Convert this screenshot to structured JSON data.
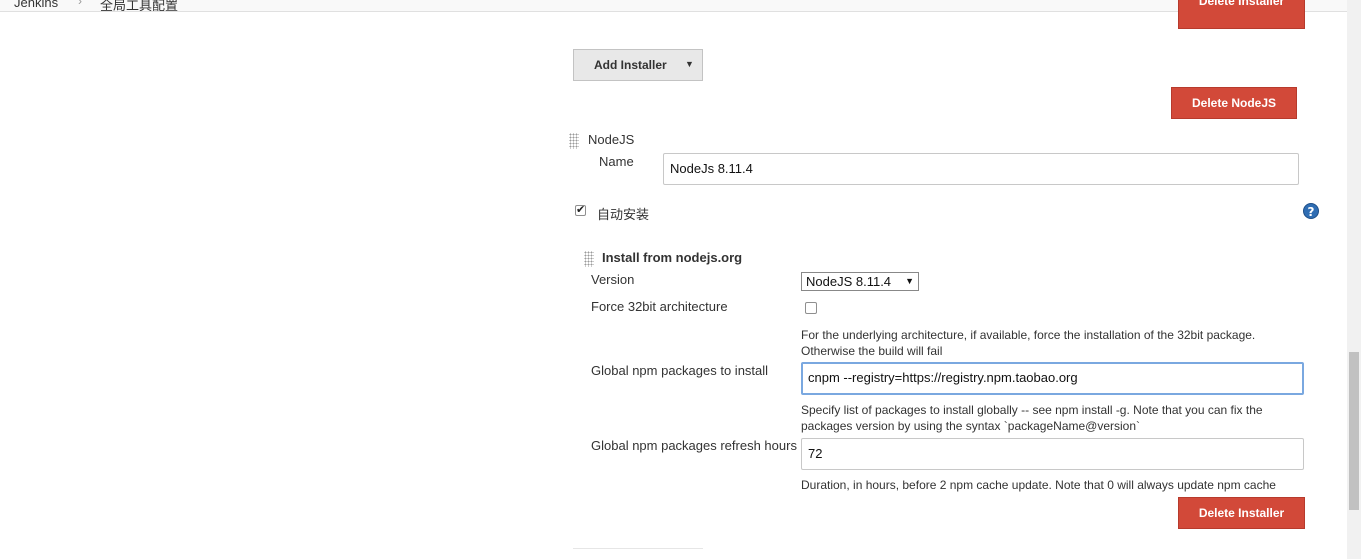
{
  "breadcrumb": {
    "item1": "Jenkins",
    "item2": "全局工具配置"
  },
  "buttons": {
    "delete_installer_top": "Delete Installer",
    "add_installer": "Add Installer",
    "delete_nodejs": "Delete NodeJS",
    "delete_installer_bottom": "Delete Installer"
  },
  "nodejs": {
    "section_title": "NodeJS",
    "name_label": "Name",
    "name_value": "NodeJs 8.11.4",
    "auto_install_label": "自动安装",
    "auto_install_checked": true
  },
  "installer": {
    "title": "Install from nodejs.org",
    "version_label": "Version",
    "version_value": "NodeJS 8.11.4",
    "force32_label": "Force 32bit architecture",
    "force32_checked": false,
    "force32_help_line1": "For the underlying architecture, if available, force the installation of the 32bit package.",
    "force32_help_line2": "Otherwise the build will fail",
    "npm_packages_label": "Global npm packages to install",
    "npm_packages_value": "cnpm --registry=https://registry.npm.taobao.org",
    "npm_packages_help_line1": "Specify list of packages to install globally -- see npm install -g. Note that you can fix the",
    "npm_packages_help_line2": "packages version by using the syntax `packageName@version`",
    "refresh_label": "Global npm packages refresh hours",
    "refresh_value": "72",
    "refresh_help": "Duration, in hours, before 2 npm cache update. Note that 0 will always update npm cache"
  },
  "icons": {
    "help": "help-icon",
    "dropdown": "caret-down-icon",
    "grip": "drag-handle-icon"
  },
  "colors": {
    "danger": "#d24939",
    "help_icon": "#2f6db3",
    "focus_border": "#7aa8e0"
  }
}
